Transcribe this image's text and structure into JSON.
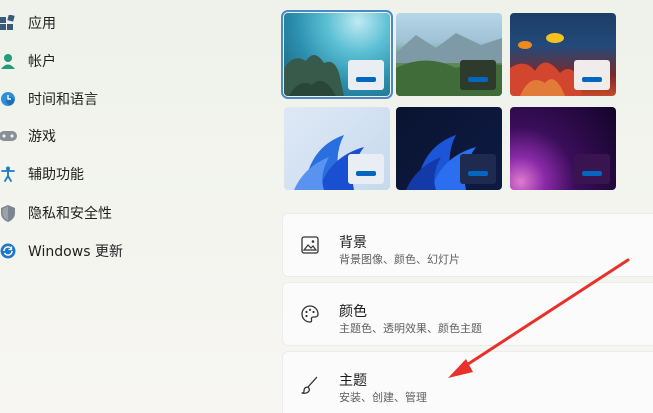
{
  "sidebar": {
    "items": [
      {
        "label": "应用",
        "icon": "apps-icon"
      },
      {
        "label": "帐户",
        "icon": "account-icon"
      },
      {
        "label": "时间和语言",
        "icon": "time-language-icon"
      },
      {
        "label": "游戏",
        "icon": "gaming-icon"
      },
      {
        "label": "辅助功能",
        "icon": "accessibility-icon"
      },
      {
        "label": "隐私和安全性",
        "icon": "privacy-shield-icon"
      },
      {
        "label": "Windows 更新",
        "icon": "windows-update-icon"
      }
    ]
  },
  "themes": {
    "thumbnails": [
      {
        "name": "underwater-theme",
        "selected": true
      },
      {
        "name": "landscape-theme",
        "selected": false
      },
      {
        "name": "coral-reef-theme",
        "selected": false
      },
      {
        "name": "windows-light-theme",
        "selected": false
      },
      {
        "name": "windows-dark-theme",
        "selected": false
      },
      {
        "name": "glow-theme",
        "selected": false
      }
    ]
  },
  "cards": {
    "background": {
      "title": "背景",
      "subtitle": "背景图像、颜色、幻灯片",
      "icon": "image-icon"
    },
    "colors": {
      "title": "颜色",
      "subtitle": "主题色、透明效果、颜色主题",
      "icon": "palette-icon"
    },
    "themes": {
      "title": "主题",
      "subtitle": "安装、创建、管理",
      "icon": "brush-icon"
    }
  },
  "colors": {
    "accent": "#0067c0",
    "annotation_arrow": "#e8312a"
  }
}
